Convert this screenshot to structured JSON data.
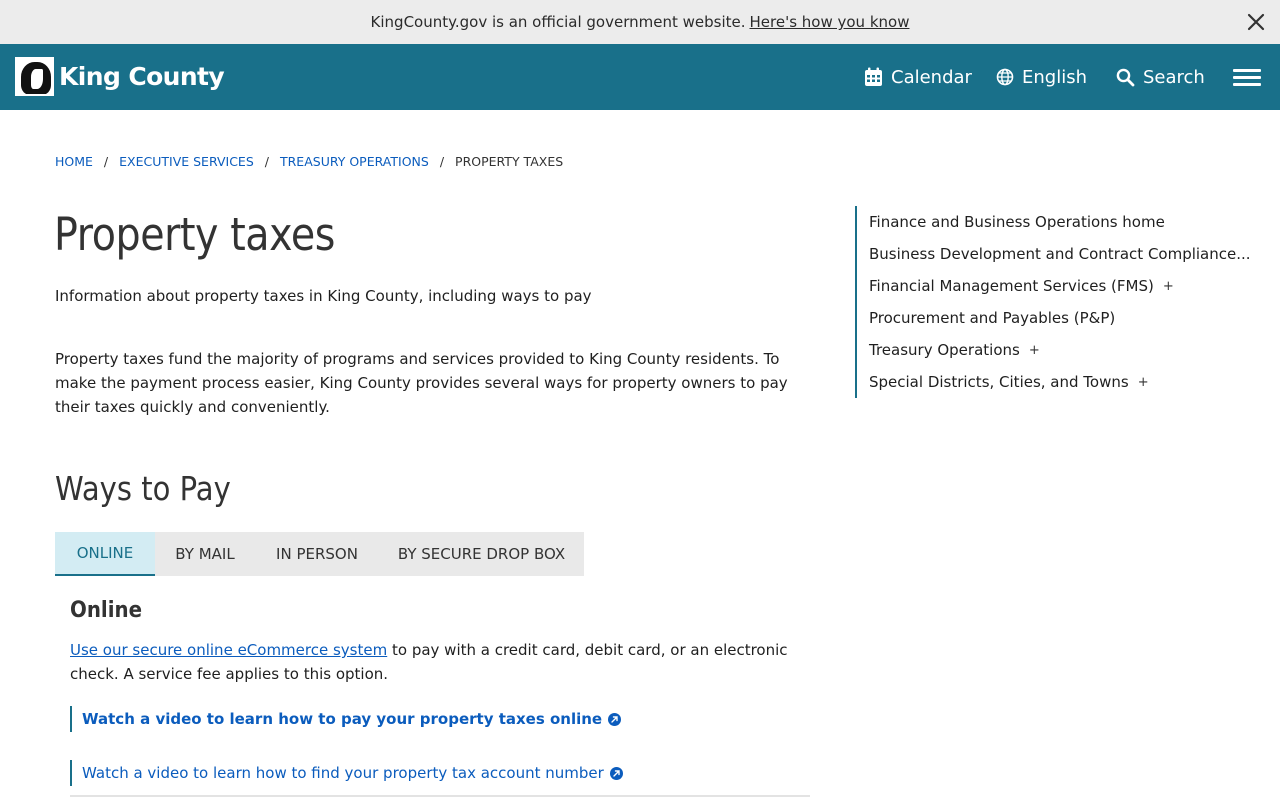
{
  "banner": {
    "text": "KingCounty.gov is an official government website.",
    "link": "Here's how you know"
  },
  "header": {
    "logo_text": "King County",
    "calendar": "Calendar",
    "language": "English",
    "search": "Search",
    "bg_color": "#19708a"
  },
  "breadcrumb": {
    "items": [
      "HOME",
      "EXECUTIVE SERVICES",
      "TREASURY OPERATIONS"
    ],
    "current": "PROPERTY TAXES",
    "separator": "/"
  },
  "main": {
    "title": "Property taxes",
    "subtitle": "Information about property taxes in King County, including ways to pay",
    "intro": "Property taxes fund the majority of programs and services provided to King County residents. To make the payment process easier, King County provides several ways for property owners to pay their taxes quickly and conveniently.",
    "section_title": "Ways to Pay",
    "tabs": [
      {
        "label": "ONLINE",
        "active": true
      },
      {
        "label": "BY MAIL",
        "active": false
      },
      {
        "label": "IN PERSON",
        "active": false
      },
      {
        "label": "BY SECURE DROP BOX",
        "active": false
      }
    ],
    "panel": {
      "title": "Online",
      "link_text": "Use our secure online eCommerce system",
      "text": " to pay with a credit card, debit card, or an electronic check. A service fee applies to this option.",
      "callouts": [
        "Watch a video to learn how to pay your property taxes online",
        "Watch a video to learn how to find your property tax account number"
      ]
    }
  },
  "sidebar": {
    "items": [
      {
        "label": "Finance and Business Operations home",
        "expand": ""
      },
      {
        "label": "Business Development and Contract Compliance...",
        "expand": ""
      },
      {
        "label": "Financial Management Services (FMS)",
        "expand": "+"
      },
      {
        "label": "Procurement and Payables (P&P)",
        "expand": ""
      },
      {
        "label": "Treasury Operations",
        "expand": "+"
      },
      {
        "label": "Special Districts, Cities, and Towns",
        "expand": "+"
      }
    ]
  },
  "icons": {
    "close": "close-icon",
    "calendar": "calendar-icon",
    "globe": "globe-icon",
    "search": "search-icon",
    "menu": "hamburger-menu-icon",
    "external": "external-link-icon"
  }
}
